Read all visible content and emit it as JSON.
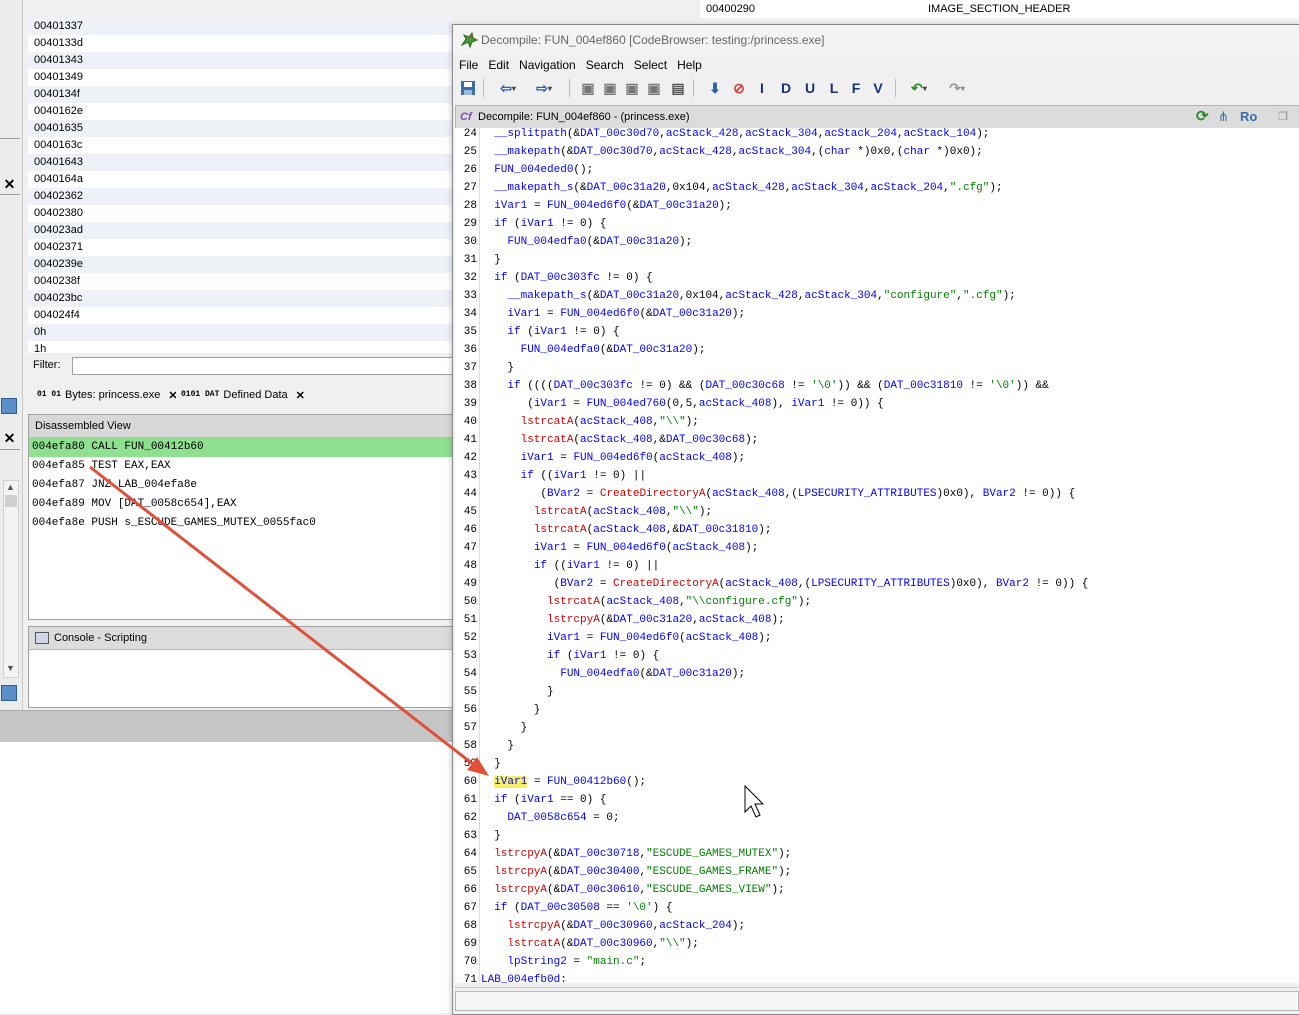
{
  "left_panel": {
    "addresses": [
      "00401337",
      "0040133d",
      "00401343",
      "00401349",
      "0040134f",
      "0040162e",
      "00401635",
      "0040163c",
      "00401643",
      "0040164a",
      "00402362",
      "00402380",
      "004023ad",
      "00402371",
      "0040239e",
      "0040238f",
      "004023bc",
      "004024f4",
      "0h",
      "1h"
    ],
    "top_row": {
      "address": "00400290",
      "type": "IMAGE_SECTION_HEADER"
    },
    "filter_label": "Filter:",
    "tabs": [
      {
        "icon": "01 01",
        "label": "Bytes: princess.exe"
      },
      {
        "icon": "0101 DAT",
        "label": "Defined Data"
      }
    ],
    "disassembled_view": {
      "title": "Disassembled View",
      "lines": [
        "004efa80 CALL FUN_00412b60",
        "004efa85 TEST EAX,EAX",
        "004efa87 JNZ LAB_004efa8e",
        "004efa89 MOV [DAT_0058c654],EAX",
        "004efa8e PUSH s_ESCUDE_GAMES_MUTEX_0055fac0"
      ]
    },
    "console_title": "Console - Scripting"
  },
  "decompile_window": {
    "title": "Decompile: FUN_004ef860 [CodeBrowser: testing:/princess.exe]",
    "menu": [
      "File",
      "Edit",
      "Navigation",
      "Search",
      "Select",
      "Help"
    ],
    "toolbar_letters": [
      "I",
      "D",
      "U",
      "L",
      "F",
      "V"
    ],
    "header_title": "Decompile: FUN_004ef860 -  (princess.exe)",
    "header_ro": "Ro",
    "lines": [
      {
        "n": "24",
        "t": "  __splitpath(&DAT_00c30d70,acStack_428,acStack_304,acStack_204,acStack_104);"
      },
      {
        "n": "25",
        "t": "  __makepath(&DAT_00c30d70,acStack_428,acStack_304,(char *)0x0,(char *)0x0);"
      },
      {
        "n": "26",
        "t": "  FUN_004eded0();"
      },
      {
        "n": "27",
        "t": "  __makepath_s(&DAT_00c31a20,0x104,acStack_428,acStack_304,acStack_204,\".cfg\");"
      },
      {
        "n": "28",
        "t": "  iVar1 = FUN_004ed6f0(&DAT_00c31a20);"
      },
      {
        "n": "29",
        "t": "  if (iVar1 != 0) {"
      },
      {
        "n": "30",
        "t": "    FUN_004edfa0(&DAT_00c31a20);"
      },
      {
        "n": "31",
        "t": "  }"
      },
      {
        "n": "32",
        "t": "  if (DAT_00c303fc != 0) {"
      },
      {
        "n": "33",
        "t": "    __makepath_s(&DAT_00c31a20,0x104,acStack_428,acStack_304,\"configure\",\".cfg\");"
      },
      {
        "n": "34",
        "t": "    iVar1 = FUN_004ed6f0(&DAT_00c31a20);"
      },
      {
        "n": "35",
        "t": "    if (iVar1 != 0) {"
      },
      {
        "n": "36",
        "t": "      FUN_004edfa0(&DAT_00c31a20);"
      },
      {
        "n": "37",
        "t": "    }"
      },
      {
        "n": "38",
        "t": "    if ((((DAT_00c303fc != 0) && (DAT_00c30c68 != '\\0')) && (DAT_00c31810 != '\\0')) &&"
      },
      {
        "n": "39",
        "t": "       (iVar1 = FUN_004ed760(0,5,acStack_408), iVar1 != 0)) {"
      },
      {
        "n": "40",
        "t": "      lstrcatA(acStack_408,\"\\\\\");"
      },
      {
        "n": "41",
        "t": "      lstrcatA(acStack_408,&DAT_00c30c68);"
      },
      {
        "n": "42",
        "t": "      iVar1 = FUN_004ed6f0(acStack_408);"
      },
      {
        "n": "43",
        "t": "      if ((iVar1 != 0) ||"
      },
      {
        "n": "44",
        "t": "         (BVar2 = CreateDirectoryA(acStack_408,(LPSECURITY_ATTRIBUTES)0x0), BVar2 != 0)) {"
      },
      {
        "n": "45",
        "t": "        lstrcatA(acStack_408,\"\\\\\");"
      },
      {
        "n": "46",
        "t": "        lstrcatA(acStack_408,&DAT_00c31810);"
      },
      {
        "n": "47",
        "t": "        iVar1 = FUN_004ed6f0(acStack_408);"
      },
      {
        "n": "48",
        "t": "        if ((iVar1 != 0) ||"
      },
      {
        "n": "49",
        "t": "           (BVar2 = CreateDirectoryA(acStack_408,(LPSECURITY_ATTRIBUTES)0x0), BVar2 != 0)) {"
      },
      {
        "n": "50",
        "t": "          lstrcatA(acStack_408,\"\\\\configure.cfg\");"
      },
      {
        "n": "51",
        "t": "          lstrcpyA(&DAT_00c31a20,acStack_408);"
      },
      {
        "n": "52",
        "t": "          iVar1 = FUN_004ed6f0(acStack_408);"
      },
      {
        "n": "53",
        "t": "          if (iVar1 != 0) {"
      },
      {
        "n": "54",
        "t": "            FUN_004edfa0(&DAT_00c31a20);"
      },
      {
        "n": "55",
        "t": "          }"
      },
      {
        "n": "56",
        "t": "        }"
      },
      {
        "n": "57",
        "t": "      }"
      },
      {
        "n": "58",
        "t": "    }"
      },
      {
        "n": "59",
        "t": "  }"
      },
      {
        "n": "60",
        "t": "  iVar1 = FUN_00412b60();"
      },
      {
        "n": "61",
        "t": "  if (iVar1 == 0) {"
      },
      {
        "n": "62",
        "t": "    DAT_0058c654 = 0;"
      },
      {
        "n": "63",
        "t": "  }"
      },
      {
        "n": "64",
        "t": "  lstrcpyA(&DAT_00c30718,\"ESCUDE_GAMES_MUTEX\");"
      },
      {
        "n": "65",
        "t": "  lstrcpyA(&DAT_00c30400,\"ESCUDE_GAMES_FRAME\");"
      },
      {
        "n": "66",
        "t": "  lstrcpyA(&DAT_00c30610,\"ESCUDE_GAMES_VIEW\");"
      },
      {
        "n": "67",
        "t": "  if (DAT_00c30508 == '\\0') {"
      },
      {
        "n": "68",
        "t": "    lstrcpyA(&DAT_00c30960,acStack_204);"
      },
      {
        "n": "69",
        "t": "    lstrcatA(&DAT_00c30960,\"\\\\\");"
      },
      {
        "n": "70",
        "t": "    lpString2 = \"main.c\";"
      },
      {
        "n": "71",
        "t": "LAB_004efb0d:"
      }
    ]
  },
  "colors": {
    "keyword": "#0000ff",
    "function_call": "#0000ff",
    "api_call": "#d00000",
    "string": "#008000",
    "highlight_var": "#f7f067",
    "disasm_highlight": "#8fe08f",
    "arrow": "#e0503a"
  }
}
